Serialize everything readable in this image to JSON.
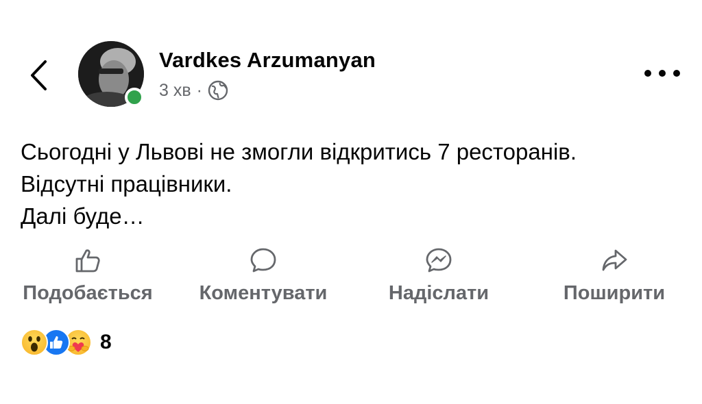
{
  "post": {
    "author_name": "Vardkes Arzumanyan",
    "time": "3 хв",
    "separator": "·",
    "privacy_icon": "globe-icon",
    "text_lines": [
      "Сьогодні у Львові не змогли відкритись 7 ресторанів.",
      "Відсутні працівники.",
      "Далі буде…"
    ]
  },
  "header": {
    "back_icon": "chevron-left-icon",
    "more_icon": "more-horizontal-icon",
    "online_status_color": "#31a24c"
  },
  "actions": {
    "like_label": "Подобається",
    "comment_label": "Коментувати",
    "send_label": "Надіслати",
    "share_label": "Поширити"
  },
  "reactions": {
    "icons": [
      "wow-emoji-icon",
      "like-reaction-icon",
      "care-emoji-icon"
    ],
    "count": "8"
  },
  "colors": {
    "text": "#050505",
    "secondary": "#65676b",
    "like_blue": "#1877f2"
  }
}
